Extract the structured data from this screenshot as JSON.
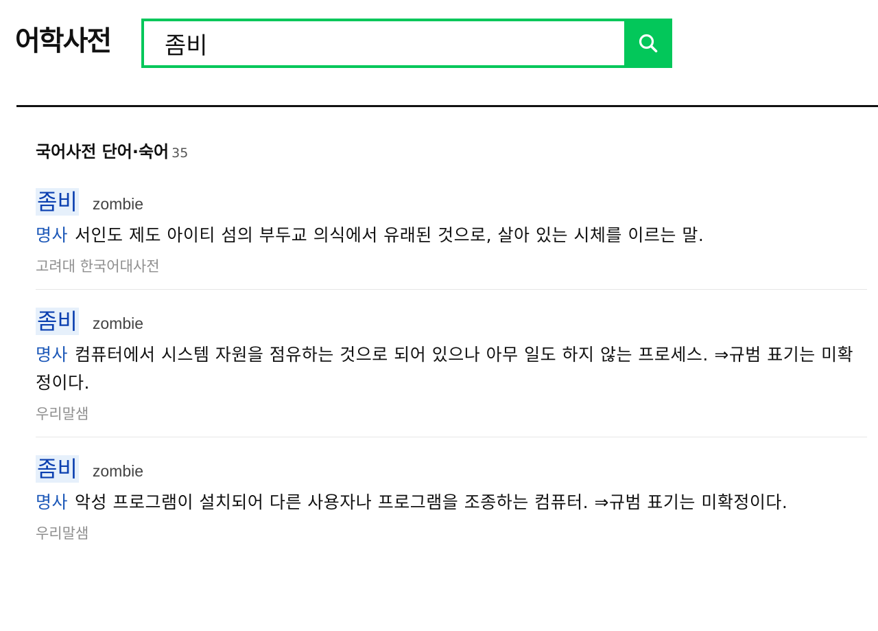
{
  "header": {
    "logo": "어학사전",
    "search_value": "좀비",
    "search_button_icon": "search-icon",
    "accent_color": "#03c75a"
  },
  "section": {
    "title": "국어사전 단어·숙어",
    "count": "35"
  },
  "entries": [
    {
      "word": "좀비",
      "origin": "zombie",
      "pos": "명사",
      "definition": "서인도 제도 아이티 섬의 부두교 의식에서 유래된 것으로, 살아 있는 시체를 이르는 말.",
      "source": "고려대 한국어대사전"
    },
    {
      "word": "좀비",
      "origin": "zombie",
      "pos": "명사",
      "definition": "컴퓨터에서 시스템 자원을 점유하는 것으로 되어 있으나 아무 일도 하지 않는 프로세스. ⇒규범 표기는 미확정이다.",
      "source": "우리말샘"
    },
    {
      "word": "좀비",
      "origin": "zombie",
      "pos": "명사",
      "definition": "악성 프로그램이 설치되어 다른 사용자나 프로그램을 조종하는 컴퓨터. ⇒규범 표기는 미확정이다.",
      "source": "우리말샘"
    }
  ]
}
